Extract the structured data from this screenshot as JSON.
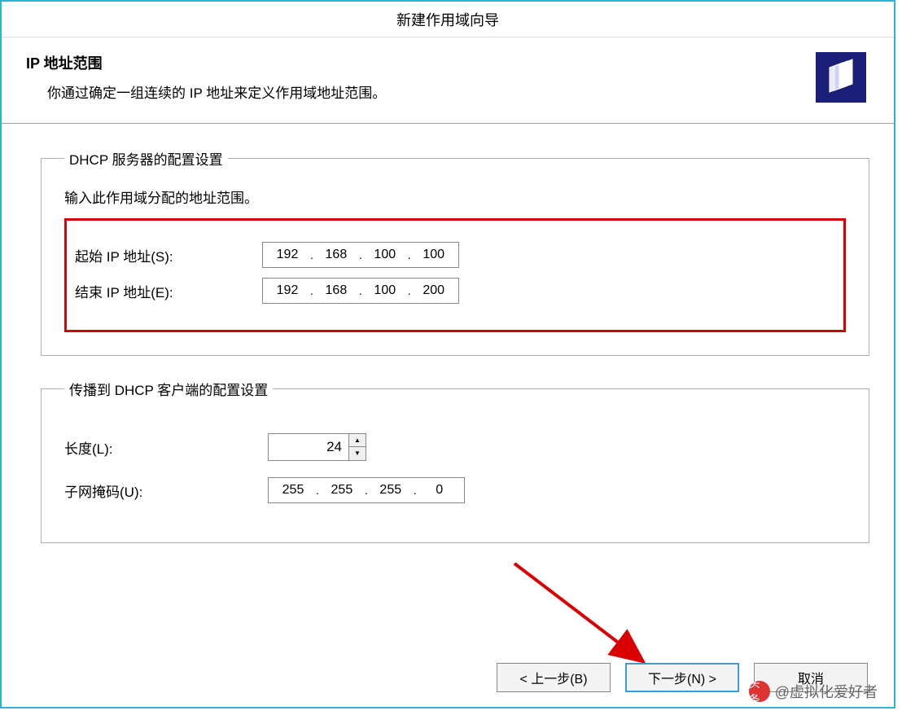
{
  "title": "新建作用域向导",
  "header": {
    "heading": "IP 地址范围",
    "sub": "你通过确定一组连续的 IP 地址来定义作用域地址范围。"
  },
  "group1": {
    "legend": "DHCP 服务器的配置设置",
    "instruction": "输入此作用域分配的地址范围。",
    "start_label": "起始 IP 地址(S):",
    "end_label": "结束 IP 地址(E):",
    "start_ip": {
      "o1": "192",
      "o2": "168",
      "o3": "100",
      "o4": "100"
    },
    "end_ip": {
      "o1": "192",
      "o2": "168",
      "o3": "100",
      "o4": "200"
    }
  },
  "group2": {
    "legend": "传播到 DHCP 客户端的配置设置",
    "length_label": "长度(L):",
    "length_value": "24",
    "mask_label": "子网掩码(U):",
    "mask": {
      "o1": "255",
      "o2": "255",
      "o3": "255",
      "o4": "0"
    }
  },
  "buttons": {
    "back": "< 上一步(B)",
    "next": "下一步(N) >",
    "cancel": "取消"
  },
  "watermark": {
    "icon_text": "头条",
    "text": "@虚拟化爱好者"
  }
}
